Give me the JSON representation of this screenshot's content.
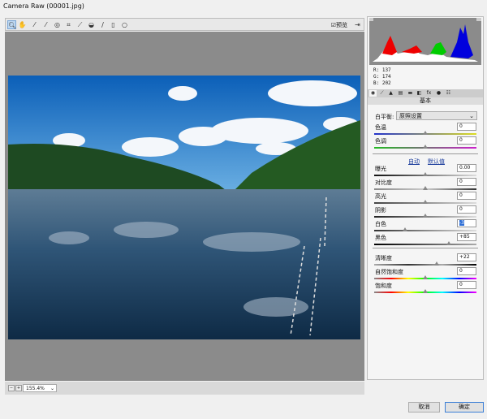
{
  "window": {
    "title": "Camera Raw (00001.jpg)"
  },
  "toolbar": {
    "tools": [
      "zoom-tool",
      "hand-tool",
      "white-balance-tool",
      "color-sampler-tool",
      "targeted-adjustment-tool",
      "crop-tool",
      "straighten-tool",
      "spot-removal-tool",
      "red-eye-tool",
      "adjustment-brush",
      "graduated-filter"
    ],
    "preview_label": "预览",
    "preview_checked": true
  },
  "bottom": {
    "zoom_value": "155.4%"
  },
  "readout": {
    "r": "R:  137",
    "g": "G:  174",
    "b": "B:  202"
  },
  "panel": {
    "section_title": "基本",
    "white_balance_label": "白平衡:",
    "white_balance_value": "原照设置",
    "auto_label": "自动",
    "default_label": "默认值",
    "sliders": [
      {
        "label": "色温",
        "value": "0",
        "pos": 0.5
      },
      {
        "label": "色调",
        "value": "0",
        "pos": 0.5
      },
      {
        "label": "曝光",
        "value": "0.00",
        "pos": 0.5
      },
      {
        "label": "对比度",
        "value": "0",
        "pos": 0.5
      },
      {
        "label": "高光",
        "value": "0",
        "pos": 0.5
      },
      {
        "label": "阴影",
        "value": "0",
        "pos": 0.5
      },
      {
        "label": "白色",
        "value": "-3",
        "pos": 0.3
      },
      {
        "label": "黑色",
        "value": "+85",
        "pos": 0.73
      },
      {
        "label": "清晰度",
        "value": "+22",
        "pos": 0.61
      },
      {
        "label": "自然饱和度",
        "value": "0",
        "pos": 0.5
      },
      {
        "label": "饱和度",
        "value": "0",
        "pos": 0.5
      }
    ]
  },
  "buttons": {
    "cancel": "取消",
    "ok": "确定"
  }
}
